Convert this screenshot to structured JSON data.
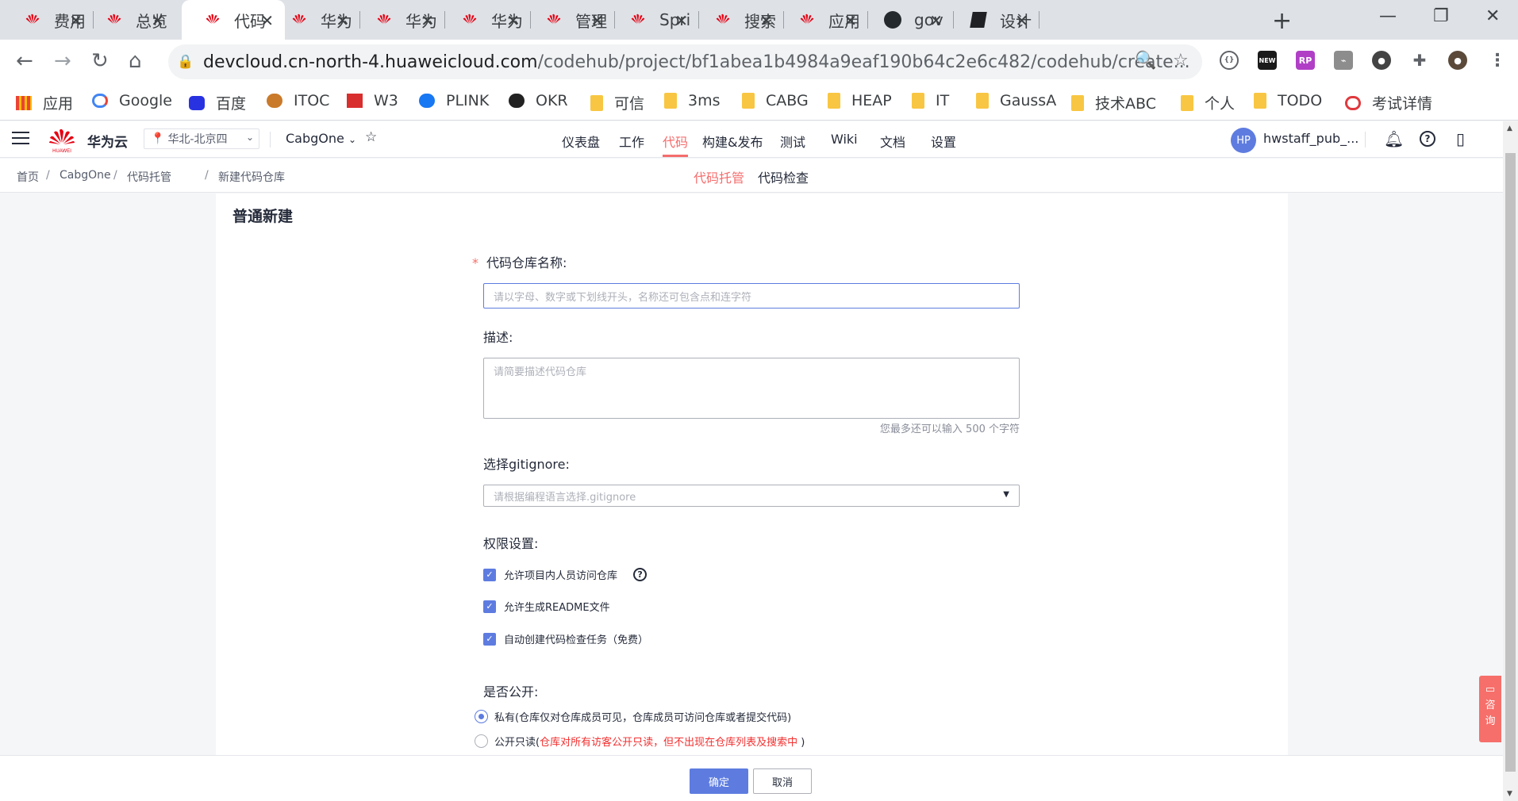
{
  "browser": {
    "tabs": [
      {
        "title": "费用",
        "x": 0
      },
      {
        "title": "总览",
        "x": 0
      },
      {
        "title": "代码",
        "x": 0
      },
      {
        "title": "华为",
        "x": 0
      },
      {
        "title": "华为",
        "x": 0
      },
      {
        "title": "华为",
        "x": 0
      },
      {
        "title": "管理",
        "x": 0
      },
      {
        "title": "Spri",
        "x": 0
      },
      {
        "title": "搜索",
        "x": 0
      },
      {
        "title": "应用",
        "x": 0
      },
      {
        "title": "gov",
        "x": 0
      },
      {
        "title": "设计",
        "x": 0
      }
    ],
    "url_host": "devcloud.cn-north-4.huaweicloud.com",
    "url_path": "/codehub/project/bf1abea1b4984a9eaf190b64c2e6c482/codehub/create...",
    "bookmarks": [
      "应用",
      "Google",
      "百度",
      "ITOC",
      "W3",
      "PLINK",
      "OKR",
      "可信",
      "3ms",
      "CABG",
      "HEAP",
      "IT",
      "GaussA",
      "技术ABC",
      "个人",
      "TODO",
      "考试详情"
    ],
    "ext_labels": {
      "new": "NEW",
      "rp": "RP"
    }
  },
  "header": {
    "logo_text": "HUAWEI",
    "brand": "华为云",
    "region": "华北-北京四",
    "project": "CabgOne",
    "nav": [
      "仪表盘",
      "工作",
      "代码",
      "构建&发布",
      "测试",
      "Wiki",
      "文档",
      "设置"
    ],
    "nav_active": "代码",
    "avatar_initials": "HP",
    "username": "hwstaff_pub_..."
  },
  "breadcrumb": [
    "首页",
    "CabgOne",
    "代码托管",
    "新建代码仓库"
  ],
  "subnav": {
    "active": "代码托管",
    "other": "代码检查"
  },
  "form": {
    "section_title": "普通新建",
    "name_label": "代码仓库名称:",
    "name_required_mark": "*",
    "name_placeholder": "请以字母、数字或下划线开头，名称还可包含点和连字符",
    "desc_label": "描述:",
    "desc_placeholder": "请简要描述代码仓库",
    "desc_hint": "您最多还可以输入 500 个字符",
    "gitignore_label": "选择gitignore:",
    "gitignore_placeholder": "请根据编程语言选择.gitignore",
    "perm_label": "权限设置:",
    "perm_options": [
      "允许项目内人员访问仓库",
      "允许生成README文件",
      "自动创建代码检查任务（免费）"
    ],
    "public_label": "是否公开:",
    "private_option": "私有(仓库仅对仓库成员可见，仓库成员可访问仓库或者提交代码)",
    "public_option_prefix": "公开只读(",
    "public_option_warning": "仓库对所有访客公开只读，但不出现在仓库列表及搜索中",
    "public_option_suffix": " )"
  },
  "footer": {
    "confirm": "确定",
    "cancel": "取消"
  },
  "consult": [
    "咨",
    "询"
  ],
  "colors": {
    "accent": "#5e7ce0",
    "active_nav": "#f56c6c",
    "warning": "#f23030"
  }
}
